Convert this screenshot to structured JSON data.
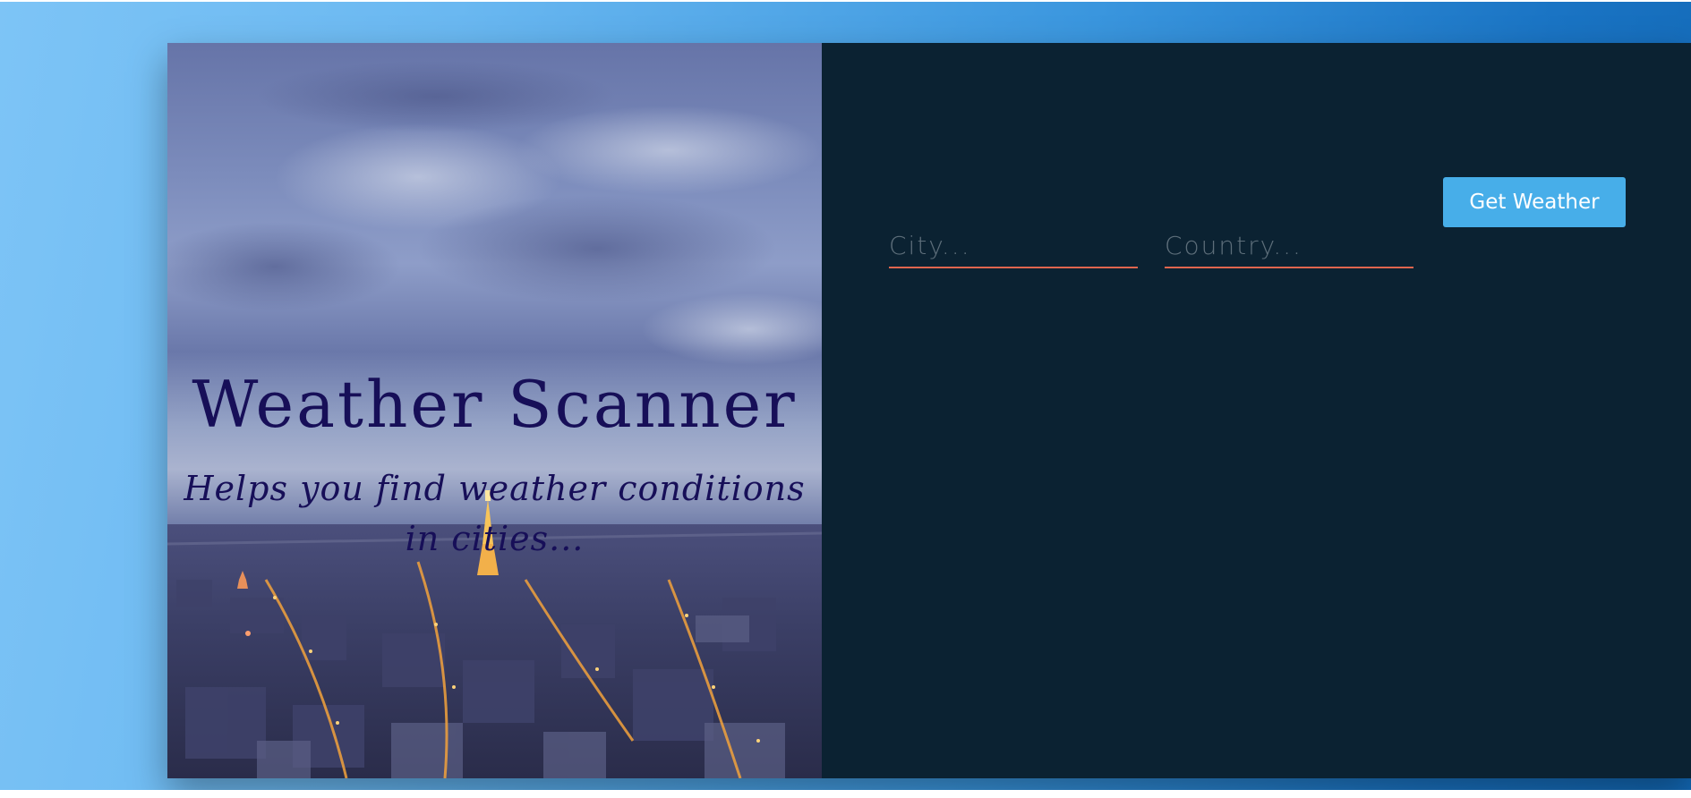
{
  "hero": {
    "title": "Weather Scanner",
    "subtitle": "Helps you find weather conditions in cities..."
  },
  "form": {
    "city_placeholder": "City...",
    "city_value": "",
    "country_placeholder": "Country...",
    "country_value": "",
    "submit_label": "Get Weather"
  },
  "colors": {
    "panel_background": "#0b2232",
    "button_background": "#47aee9",
    "input_underline": "#e0654e",
    "title_text": "#170f58"
  }
}
